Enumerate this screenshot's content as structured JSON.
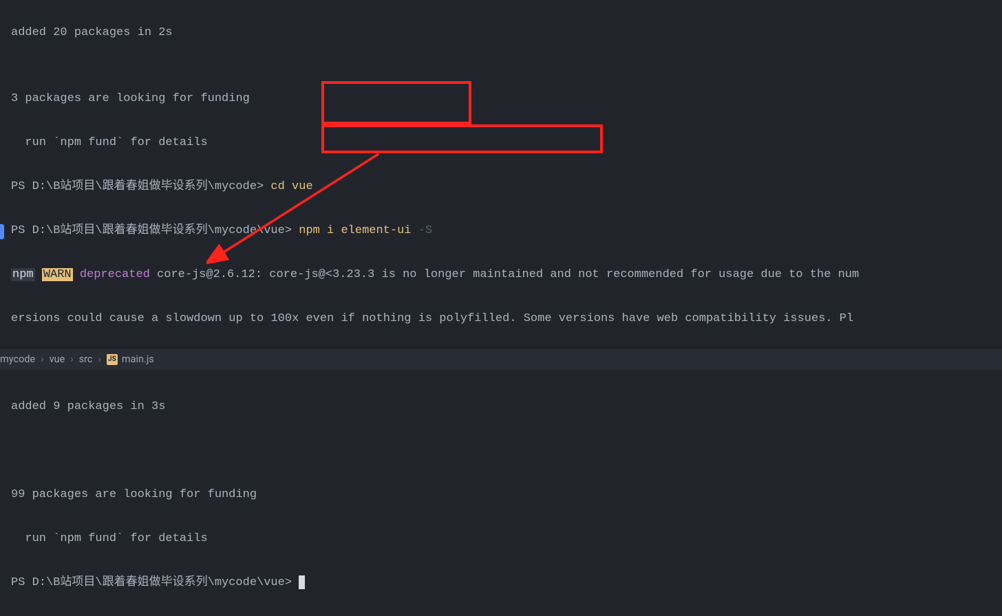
{
  "terminal": {
    "line1": "added 20 packages in 2s",
    "line2": "",
    "line3": "3 packages are looking for funding",
    "line4": "  run `npm fund` for details",
    "prompt1_path": "PS D:\\B站项目\\跟着春姐做毕设系列\\mycode>",
    "cmd1": " cd vue",
    "prompt2_path": "PS D:\\B站项目\\跟着春姐做毕设系列\\mycode\\vue>",
    "cmd2_a": " npm i element-ui ",
    "cmd2_b": "-S",
    "npm_label": "npm",
    "warn_label": "WARN",
    "dep_label": " deprecated",
    "dep_text1": " core-js@2.6.12: core-js@<3.23.3 is no longer maintained and not recommended for usage due to the num",
    "dep_text2": "ersions could cause a slowdown up to 100x even if nothing is polyfilled. Some versions have web compatibility issues. Pl",
    "line_added2": "added 9 packages in 3s",
    "line_look2": "99 packages are looking for funding",
    "line_run2": "  run `npm fund` for details",
    "prompt3_path": "PS D:\\B站项目\\跟着春姐做毕设系列\\mycode\\vue> "
  },
  "breadcrumb": {
    "c1": "mycode",
    "c2": "vue",
    "c3": "src",
    "c4": "main.js",
    "jsIcon": "JS"
  }
}
